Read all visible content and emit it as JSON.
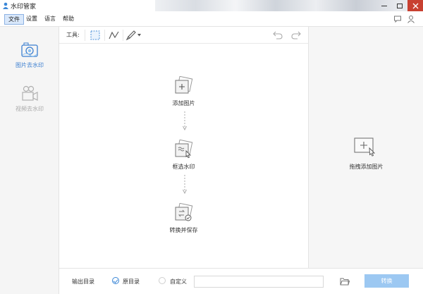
{
  "window": {
    "title": "水印管家"
  },
  "menu": {
    "items": [
      "文件",
      "设置",
      "语言",
      "帮助"
    ]
  },
  "sidebar": {
    "items": [
      {
        "label": "图片去水印"
      },
      {
        "label": "视频去水印"
      }
    ]
  },
  "toolbar": {
    "label": "工具:"
  },
  "steps": [
    {
      "label": "添加图片"
    },
    {
      "label": "框选水印"
    },
    {
      "label": "转换并保存"
    }
  ],
  "rightpanel": {
    "hint": "拖拽添加图片"
  },
  "bottom": {
    "output_label": "输出目录",
    "opt_original": "原目录",
    "opt_custom": "自定义",
    "path_value": "",
    "convert_label": "转换"
  },
  "colors": {
    "accent": "#3c7fd0",
    "close": "#c84031",
    "convert_btn": "#9cc8f2"
  }
}
